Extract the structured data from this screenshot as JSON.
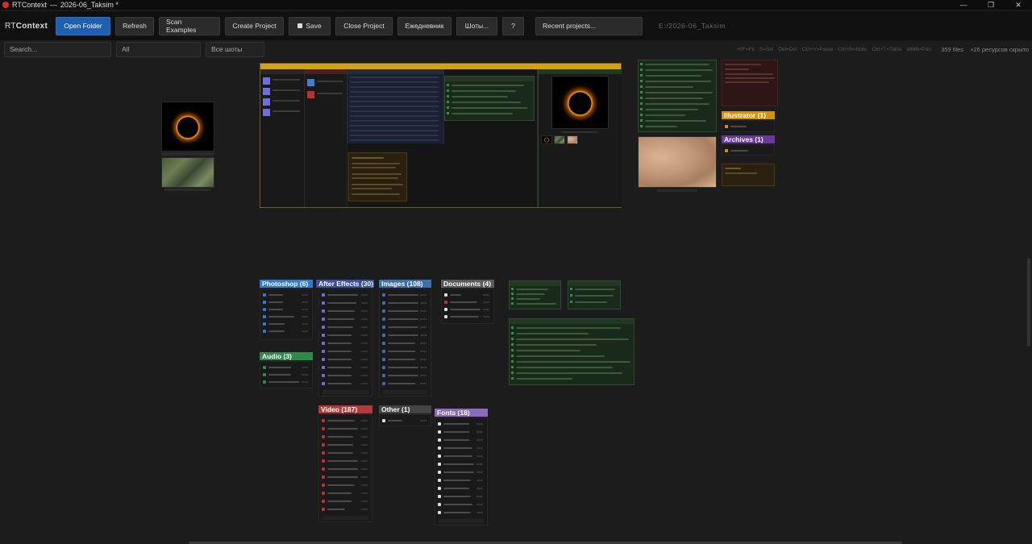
{
  "titlebar": {
    "app": "RTContext",
    "separator": "—",
    "project": "2026-06_Taksim *"
  },
  "toolbar": {
    "brand_prefix": "RT",
    "brand_suffix": "Context",
    "open_folder": "Open Folder",
    "refresh": "Refresh",
    "scan_examples": "Scan Examples",
    "create_project": "Create Project",
    "save": "Save",
    "close_project": "Close Project",
    "planner": "Ежедневник",
    "shots": "Шоты...",
    "help": "?",
    "recent_projects": "Recent projects...",
    "path": "E:/2026-06_Taksim"
  },
  "filterbar": {
    "search_placeholder": "Search...",
    "type_filter": "All",
    "shots_filter": "Все шоты",
    "shortcuts": [
      "H/F=Fit",
      "S=Sel",
      "Del=Del",
      "Ctrl+V=Paste",
      "Ctrl+N=Note",
      "Ctrl+T=Table",
      "MMB=Pan"
    ],
    "file_count": "359 files",
    "hidden_count": "+26 ресурсов скрыто"
  },
  "groups": {
    "photoshop": {
      "label": "Photoshop",
      "count": "(6)",
      "color": "#2d7bd6"
    },
    "after_effects": {
      "label": "After Effects",
      "count": "(30)",
      "color": "#3a50a8"
    },
    "images": {
      "label": "Images",
      "count": "(108)",
      "color": "#3b6fb0"
    },
    "documents": {
      "label": "Documents",
      "count": "(4)",
      "color": "#5a5a5a"
    },
    "audio": {
      "label": "Audio",
      "count": "(3)",
      "color": "#2f8a4a"
    },
    "video": {
      "label": "Video",
      "count": "(187)",
      "color": "#b33a3a"
    },
    "other": {
      "label": "Other",
      "count": "(1)",
      "color": "#444444"
    },
    "fonts": {
      "label": "Fonts",
      "count": "(18)",
      "color": "#8c6ac0"
    },
    "illustrator": {
      "label": "Illustrator",
      "count": "(1)",
      "color": "#d4900f"
    },
    "archives": {
      "label": "Archives",
      "count": "(1)",
      "color": "#6a3a9a"
    }
  },
  "project_card": {
    "accent": "#d4a017"
  }
}
